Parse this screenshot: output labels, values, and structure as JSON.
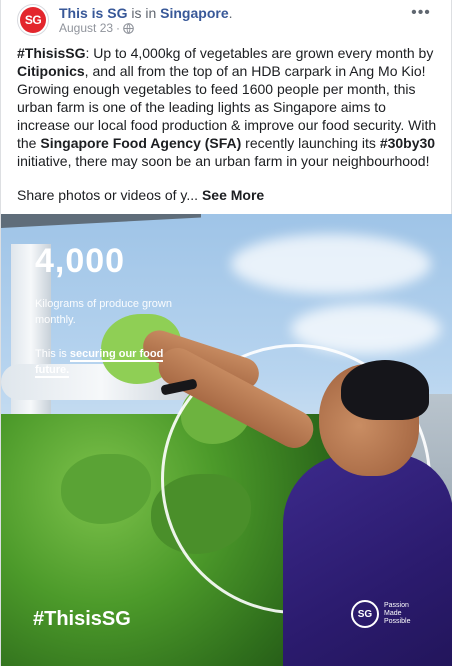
{
  "post": {
    "author": "This is SG",
    "is_in_text": "is in",
    "location": "Singapore",
    "date": "August 23",
    "separator": "·",
    "avatar_text": "SG",
    "more_glyph": "•••",
    "body": {
      "p1_hashtag": "#ThisisSG",
      "p1_a": ": Up to 4,000kg of vegetables are grown every month by ",
      "p1_citiponics": "Citiponics",
      "p1_b": ", and all from the top of an HDB carpark in Ang Mo Kio! Growing enough vegetables to feed 1600 people per month, this urban farm is one of the leading lights as Singapore aims to increase our local food production & improve our food security. With the ",
      "p1_sfa": "Singapore Food Agency (SFA)",
      "p1_c": " recently launching its ",
      "p1_30by30": "#30by30",
      "p1_d": " initiative, there may soon be an urban farm in your neighbourhood!"
    },
    "share_text": "Share photos or videos of y...",
    "see_more": "See More"
  },
  "media": {
    "stat_number": "4,000",
    "stat_desc": "Kilograms of produce grown monthly.",
    "line2_a": "This is ",
    "line2_u": "securing our food future.",
    "hashtag": "#ThisisSG",
    "logo_text": "SG",
    "logo_tagline": "Passion Made Possible"
  },
  "colors": {
    "link": "#385898",
    "brand_red": "#e3262d",
    "shirt": "#2b1b6e"
  },
  "icons": {
    "globe": "globe-icon",
    "more": "more-options-icon"
  }
}
